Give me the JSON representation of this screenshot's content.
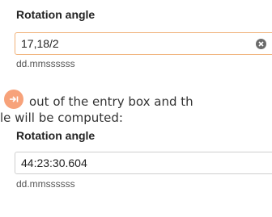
{
  "field1": {
    "label": "Rotation angle",
    "value": "17,18/2",
    "hint": "dd.mmssssss"
  },
  "instruction": {
    "line1": "out of the entry box and th",
    "line2": "le will be computed:"
  },
  "field2": {
    "label": "Rotation angle",
    "value": "44:23:30.604",
    "hint": "dd.mmssssss"
  },
  "icons": {
    "tab_key": "tab-key-icon",
    "clear": "clear-icon"
  },
  "colors": {
    "tab_icon_bg": "#f7a27a",
    "focused_border": "#f0b27a"
  }
}
